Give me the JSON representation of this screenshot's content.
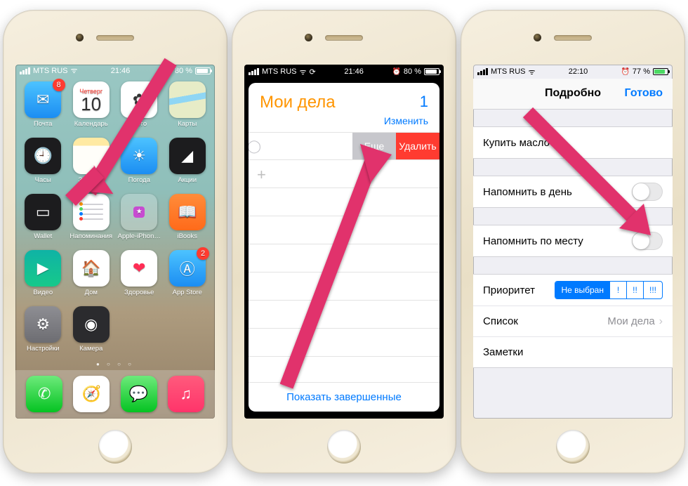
{
  "status": {
    "carrier": "MTS RUS",
    "time1": "21:46",
    "time2": "21:46",
    "time3": "22:10",
    "battery1": "80 %",
    "battery3": "77 %",
    "battery_fill1": "80%",
    "battery_fill3": "77%"
  },
  "phone1": {
    "cal_day": "Четверг",
    "cal_num": "10",
    "apps": [
      {
        "label": "Почта",
        "bg": "bg-blue",
        "glyph": "✉︎",
        "badge": "8"
      },
      {
        "label": "Календарь"
      },
      {
        "label": "Фото",
        "bg": "bg-grad1",
        "glyph": "✿"
      },
      {
        "label": "Карты",
        "bg": "bg-maps",
        "glyph": "📍"
      },
      {
        "label": "Часы",
        "bg": "bg-black",
        "glyph": "🕘"
      },
      {
        "label": "Заметки",
        "bg": "bg-white",
        "glyph": "✎"
      },
      {
        "label": "Погода",
        "bg": "bg-blue",
        "glyph": "☁︎"
      },
      {
        "label": "Акции",
        "bg": "bg-black",
        "glyph": "📈"
      },
      {
        "label": "Wallet",
        "bg": "bg-black",
        "glyph": "💳"
      },
      {
        "label": "Напоминания"
      },
      {
        "label": "Apple-iPhon…",
        "bg": "bg-purple",
        "glyph": "★"
      },
      {
        "label": "iBooks",
        "bg": "bg-orange2",
        "glyph": "📖"
      },
      {
        "label": "Видео",
        "bg": "bg-teal",
        "glyph": "▶"
      },
      {
        "label": "Дом",
        "bg": "bg-homekit",
        "glyph": "🏠"
      },
      {
        "label": "Здоровье",
        "bg": "bg-white",
        "glyph": "❤︎"
      },
      {
        "label": "App Store",
        "bg": "bg-blue",
        "glyph": "Ⓐ",
        "badge": "2"
      },
      {
        "label": "Настройки",
        "bg": "bg-gray",
        "glyph": "⚙︎"
      },
      {
        "label": "Камера",
        "bg": "bg-dark",
        "glyph": "📷"
      }
    ],
    "dock": [
      {
        "bg": "bg-green",
        "glyph": "✆"
      },
      {
        "bg": "bg-safari",
        "glyph": "🧭"
      },
      {
        "bg": "bg-green",
        "glyph": "💬"
      },
      {
        "bg": "bg-music",
        "glyph": "♫"
      }
    ]
  },
  "phone2": {
    "list_title": "Мои дела",
    "list_count": "1",
    "edit": "Изменить",
    "swipe_more": "Еще",
    "swipe_delete": "Удалить",
    "show_completed": "Показать завершенные",
    "add": "+"
  },
  "phone3": {
    "nav_title": "Подробно",
    "nav_done": "Готово",
    "item_title": "Купить масло",
    "remind_day": "Напомнить в день",
    "remind_loc": "Напомнить по месту",
    "priority_label": "Приоритет",
    "priority_none": "Не выбран",
    "p1": "!",
    "p2": "!!",
    "p3": "!!!",
    "list_label": "Список",
    "list_value": "Мои дела",
    "notes_label": "Заметки"
  }
}
